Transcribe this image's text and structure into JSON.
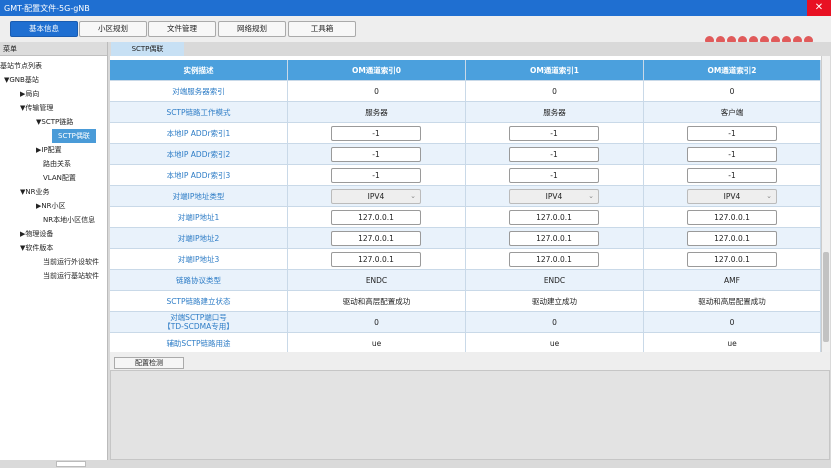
{
  "window": {
    "title": "GMT-配置文件-5G-gNB"
  },
  "toolbar": {
    "buttons": [
      "基本信息",
      "小区规划",
      "文件管理",
      "网络规划",
      "工具箱"
    ]
  },
  "colors": {
    "accent": "#1f6fd1",
    "header": "#4ba0dd",
    "status_dots": "#e05a5a"
  },
  "left_panel": {
    "header": "菜单",
    "items": [
      "基站节点列表",
      "▼GNB基站",
      "▶局向",
      "▼传输管理",
      "▼SCTP链路",
      "SCTP偶联",
      "▶IP配置",
      "路由关系",
      "VLAN配置",
      "▼NR业务",
      "▶NR小区",
      "NR本地小区信息",
      "▶物理设备",
      "▼软件版本",
      "当前运行外设软件",
      "当前运行基站软件"
    ]
  },
  "tab": {
    "label": "SCTP偶联"
  },
  "table": {
    "headers": [
      "实例描述",
      "OM通道索引0",
      "OM通道索引1",
      "OM通道索引2"
    ],
    "rows": [
      {
        "label": "对端服务器索引",
        "values": [
          "0",
          "0",
          "0"
        ]
      },
      {
        "label": "SCTP链路工作模式",
        "values": [
          "服务器",
          "服务器",
          "客户端"
        ]
      },
      {
        "label": "本地IP ADDr索引1",
        "values": [
          "-1",
          "-1",
          "-1"
        ]
      },
      {
        "label": "本地IP ADDr索引2",
        "values": [
          "-1",
          "-1",
          "-1"
        ]
      },
      {
        "label": "本地IP ADDr索引3",
        "values": [
          "-1",
          "-1",
          "-1"
        ]
      },
      {
        "label": "对端IP地址类型",
        "values": [
          "IPV4",
          "IPV4",
          "IPV4"
        ]
      },
      {
        "label": "对端IP地址1",
        "values": [
          "127.0.0.1",
          "127.0.0.1",
          "127.0.0.1"
        ]
      },
      {
        "label": "对端IP地址2",
        "values": [
          "127.0.0.1",
          "127.0.0.1",
          "127.0.0.1"
        ]
      },
      {
        "label": "对端IP地址3",
        "values": [
          "127.0.0.1",
          "127.0.0.1",
          "127.0.0.1"
        ]
      },
      {
        "label": "链路协议类型",
        "values": [
          "ENDC",
          "ENDC",
          "AMF"
        ]
      },
      {
        "label": "SCTP链路建立状态",
        "values": [
          "驱动和高层配置成功",
          "驱动建立成功",
          "驱动和高层配置成功"
        ]
      },
      {
        "label_line1": "对端SCTP端口号",
        "label_line2": "【TD-SCDMA专用】",
        "values": [
          "0",
          "0",
          "0"
        ]
      },
      {
        "label": "辅助SCTP链路用途",
        "values": [
          "ue",
          "ue",
          "ue"
        ]
      }
    ]
  },
  "bottom": {
    "check_button": "配置检测"
  }
}
